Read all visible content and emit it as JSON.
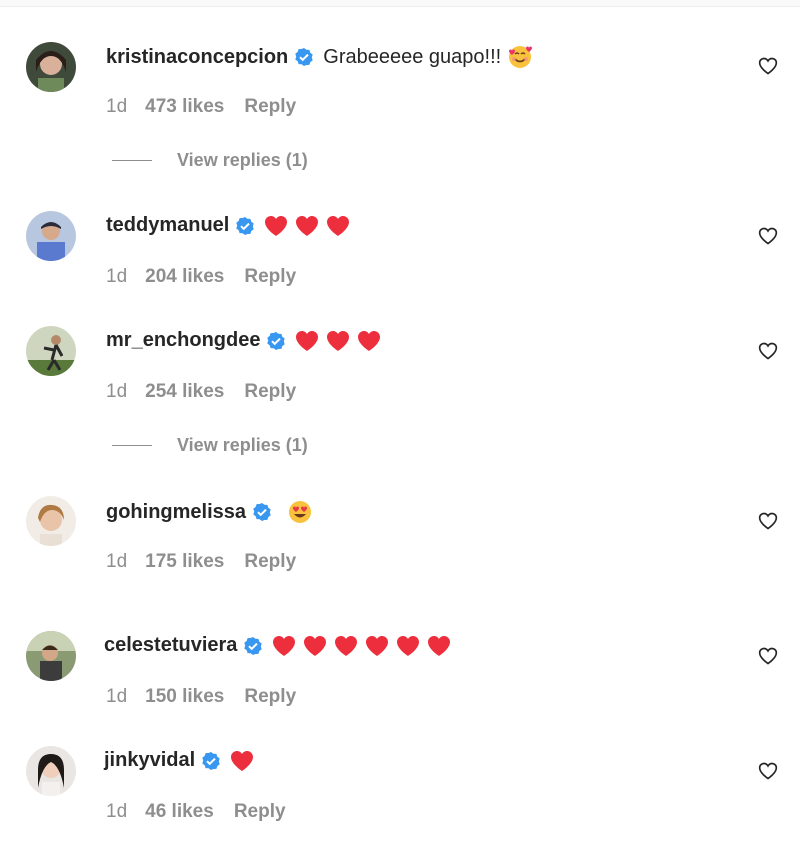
{
  "comments": [
    {
      "username": "kristinaconcepcion",
      "text": "Grabeeeee guapo!!!",
      "emoji": "smiling-face-with-hearts",
      "hearts": 0,
      "time": "1d",
      "likes": "473 likes",
      "reply": "Reply",
      "view_replies": "View replies (1)"
    },
    {
      "username": "teddymanuel",
      "text": "",
      "hearts": 3,
      "time": "1d",
      "likes": "204 likes",
      "reply": "Reply"
    },
    {
      "username": "mr_enchongdee",
      "text": "",
      "hearts": 3,
      "time": "1d",
      "likes": "254 likes",
      "reply": "Reply",
      "view_replies": "View replies (1)"
    },
    {
      "username": "gohingmelissa",
      "text": "",
      "emoji": "heart-eyes",
      "hearts": 0,
      "time": "1d",
      "likes": "175 likes",
      "reply": "Reply"
    },
    {
      "username": "celestetuviera",
      "text": "",
      "hearts": 6,
      "time": "1d",
      "likes": "150 likes",
      "reply": "Reply"
    },
    {
      "username": "jinkyvidal",
      "text": "",
      "hearts": 1,
      "time": "1d",
      "likes": "46 likes",
      "reply": "Reply"
    }
  ],
  "colors": {
    "heart": "#ed2e3c",
    "verified": "#3897f0",
    "meta": "#8e8e8e",
    "username": "#262626"
  }
}
